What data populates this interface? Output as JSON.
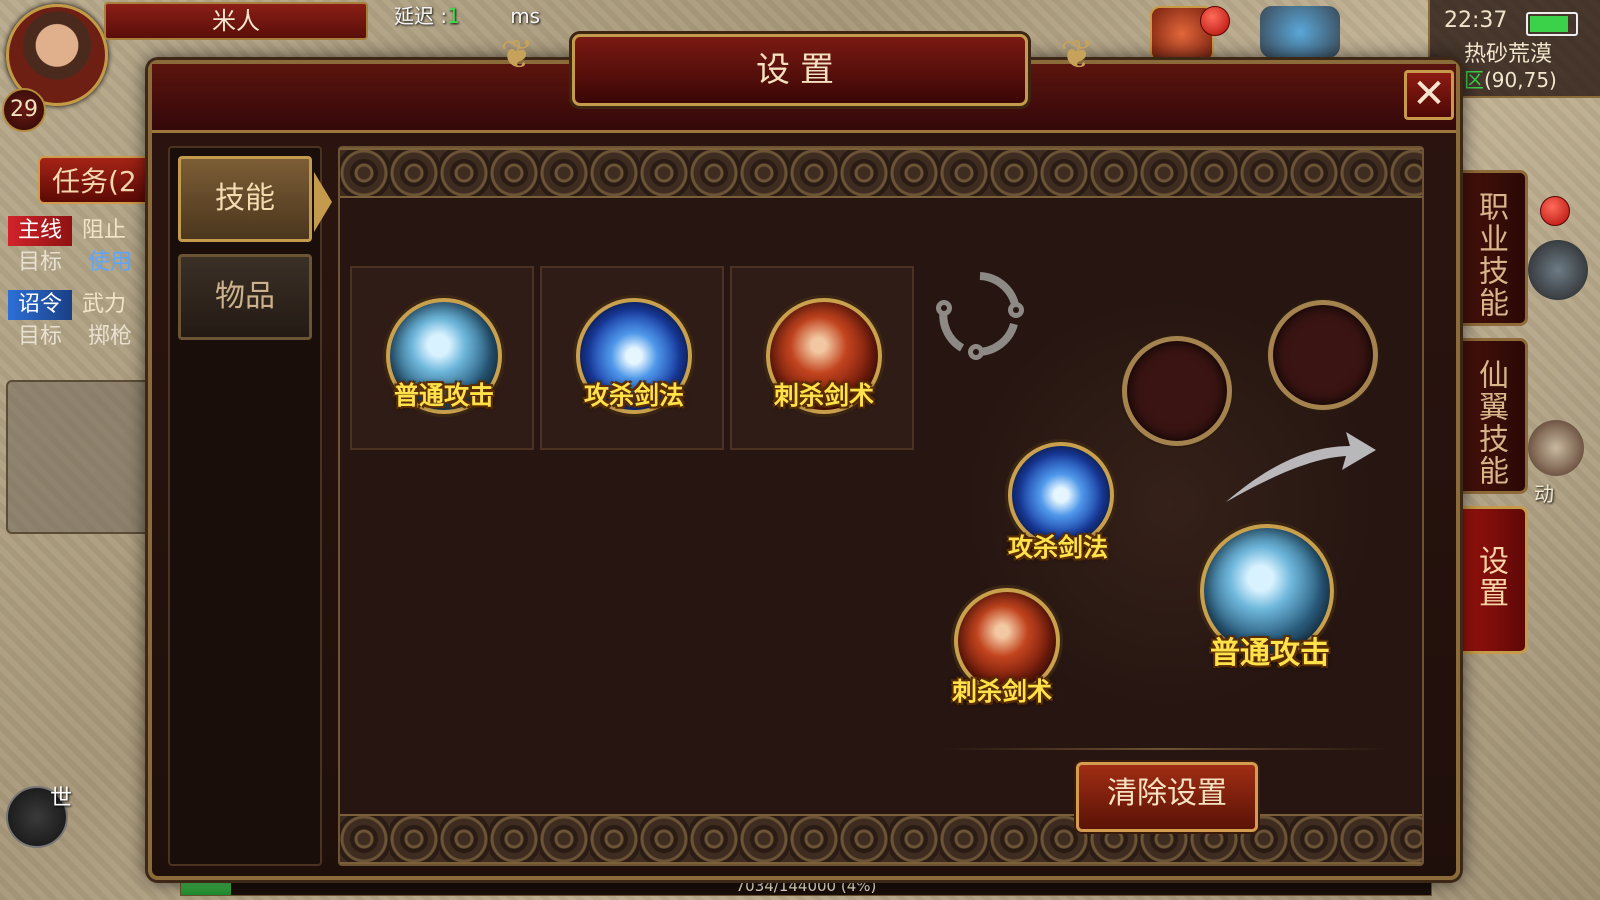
{
  "hud": {
    "player_name": "米人",
    "level": "29",
    "latency_label": "延迟 :",
    "latency_value": "1",
    "latency_unit": "ms",
    "clock": "22:37",
    "map_name": "热砂荒漠",
    "zone": "全区",
    "coords": "(90,75)",
    "quest_tab": "任务(2",
    "quests": [
      {
        "tag": "主线",
        "text": "阻止",
        "target_label": "目标",
        "target_value": "使用"
      },
      {
        "tag": "诏令",
        "text": "武力",
        "target_label": "目标",
        "target_value": "掷枪"
      }
    ],
    "world_chat": "世",
    "side_tabs": [
      "职业技能",
      "仙翼技能",
      "设置"
    ],
    "side_label": "动",
    "xp_text": "7034/144000 (4%)",
    "xp_fraction": 0.04
  },
  "settings": {
    "title": "设置",
    "close_symbol": "✕",
    "tabs": [
      "技能",
      "物品"
    ],
    "skills": [
      {
        "name": "普通攻击",
        "icon": "basic-attack-icon"
      },
      {
        "name": "攻杀剑法",
        "icon": "gongsha-sword-icon"
      },
      {
        "name": "刺杀剑术",
        "icon": "cisha-sword-icon"
      }
    ],
    "wheel": {
      "slot_a": "攻杀剑法",
      "slot_b": "刺杀剑术",
      "main": "普通攻击"
    },
    "clear_button": "清除设置"
  },
  "colors": {
    "accent_gold": "#c49a4c",
    "panel_red": "#7a1a12",
    "skill_label": "#ffe14a",
    "green": "#3bd24a"
  }
}
